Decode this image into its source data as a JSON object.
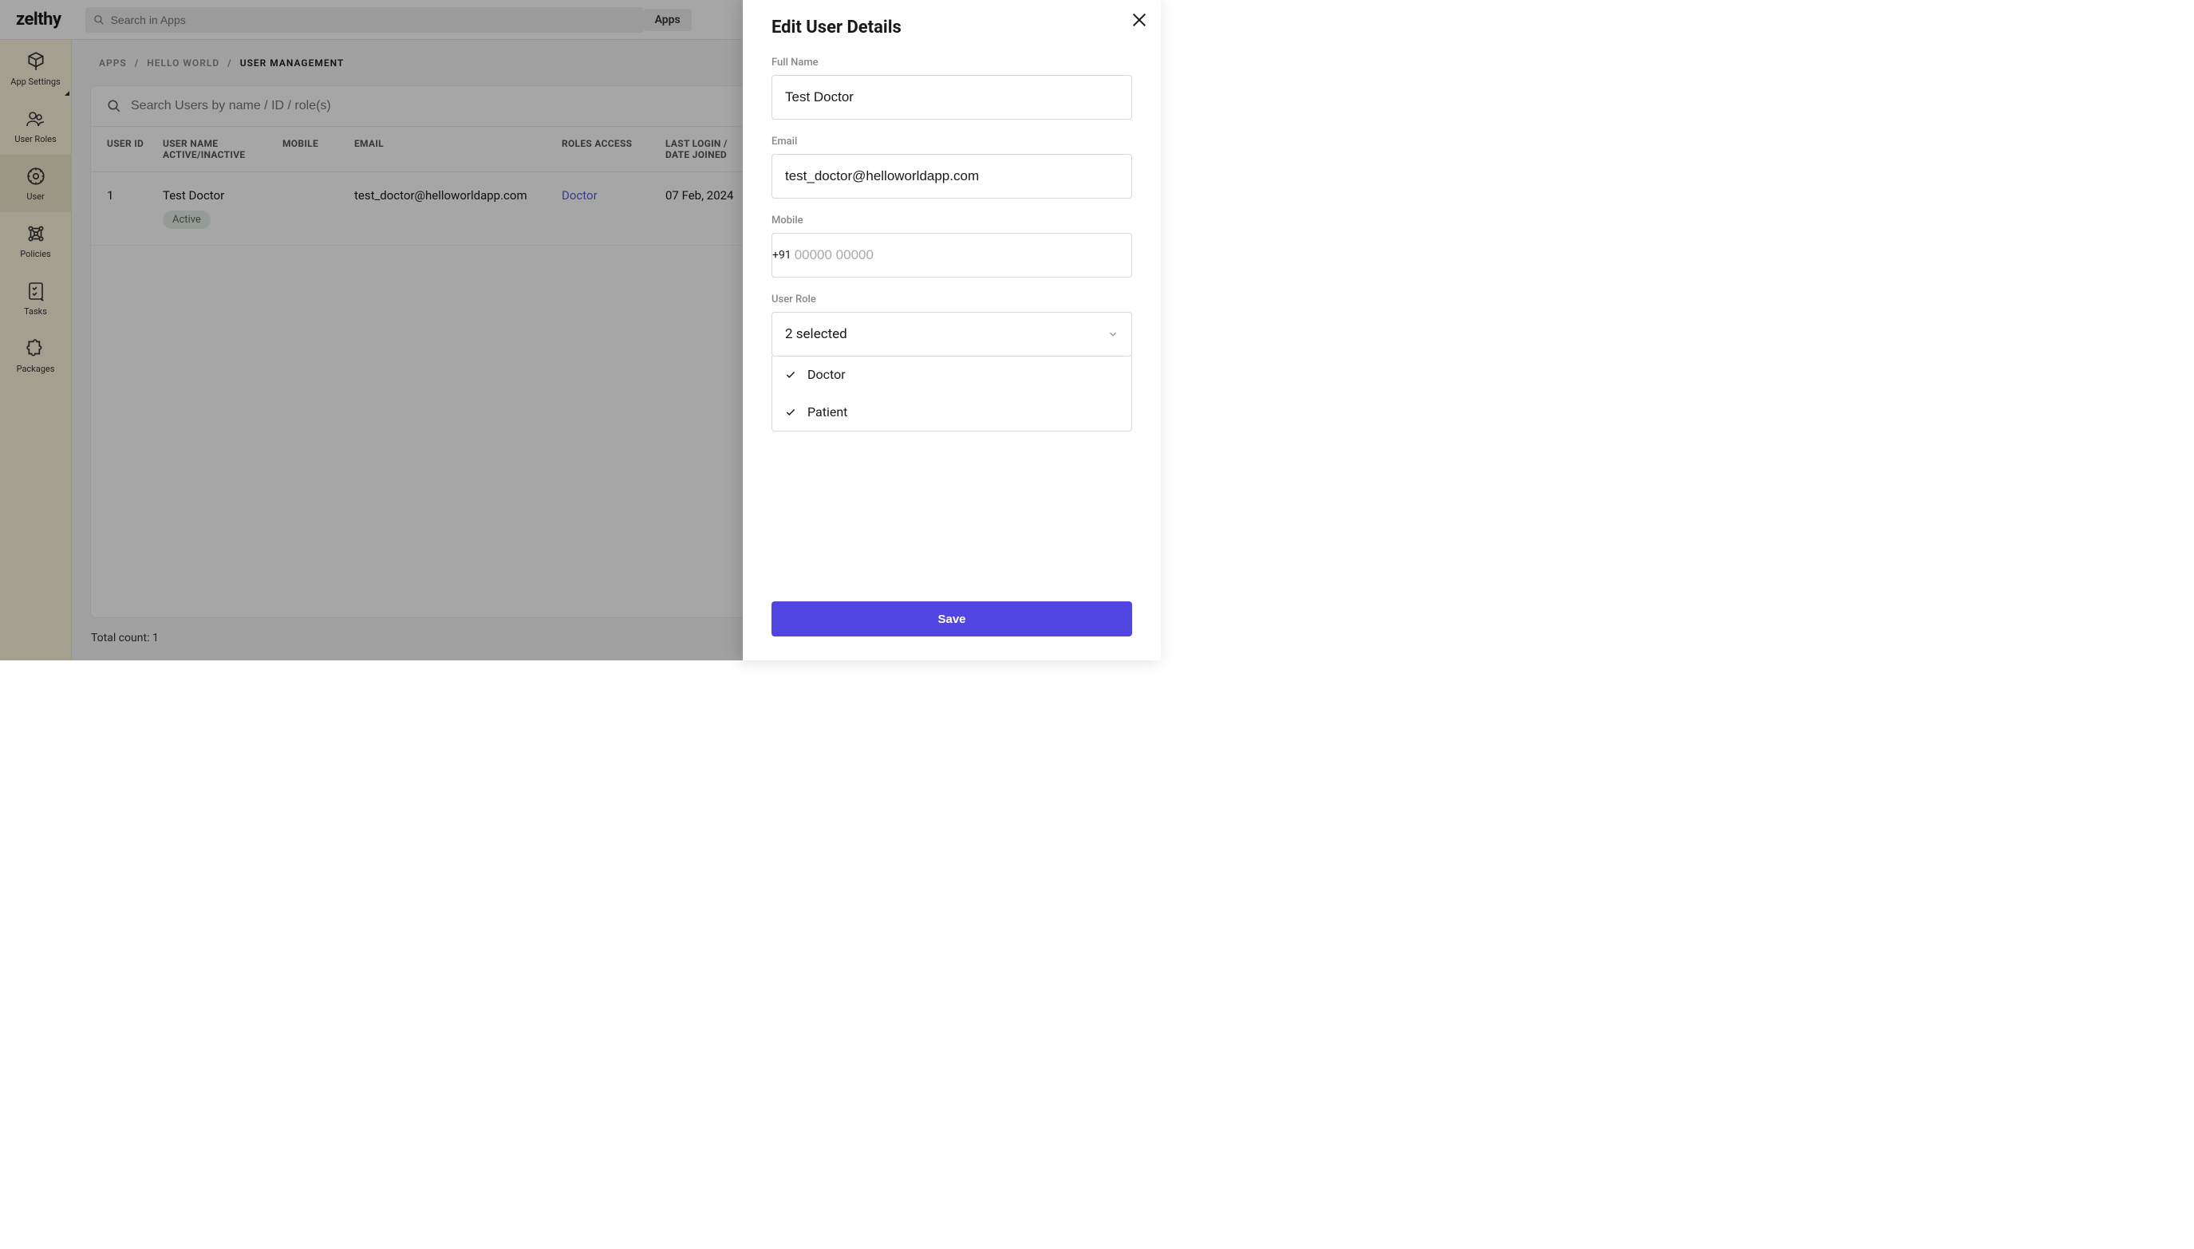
{
  "logo": "zelthy",
  "topSearch": {
    "placeholder": "Search in Apps"
  },
  "appsMenuLabel": "Apps",
  "sidebar": {
    "items": [
      {
        "label": "App Settings"
      },
      {
        "label": "User Roles"
      },
      {
        "label": "User"
      },
      {
        "label": "Policies"
      },
      {
        "label": "Tasks"
      },
      {
        "label": "Packages"
      }
    ]
  },
  "breadcrumb": {
    "a": "APPS",
    "b": "HELLO WORLD",
    "c": "USER MANAGEMENT"
  },
  "panelSearch": {
    "placeholder": "Search Users by name / ID / role(s)"
  },
  "columns": {
    "id": "USER ID",
    "name": "USER NAME ACTIVE/INACTIVE",
    "mobile": "MOBILE",
    "email": "EMAIL",
    "roles": "ROLES ACCESS",
    "date": "LAST LOGIN / DATE JOINED"
  },
  "rows": [
    {
      "id": "1",
      "name": "Test Doctor",
      "status": "Active",
      "mobile": "",
      "email": "test_doctor@helloworldapp.com",
      "roles": "Doctor",
      "date": "07 Feb, 2024"
    }
  ],
  "footer": "Total count: 1",
  "drawer": {
    "title": "Edit User Details",
    "fields": {
      "fullNameLabel": "Full Name",
      "fullNameValue": "Test Doctor",
      "emailLabel": "Email",
      "emailValue": "test_doctor@helloworldapp.com",
      "mobileLabel": "Mobile",
      "mobileCC": "+91",
      "mobilePlaceholder": "00000 00000",
      "roleLabel": "User Role",
      "roleSummary": "2 selected",
      "roleOptions": [
        {
          "label": "Doctor",
          "checked": true
        },
        {
          "label": "Patient",
          "checked": true
        }
      ]
    },
    "saveLabel": "Save"
  }
}
